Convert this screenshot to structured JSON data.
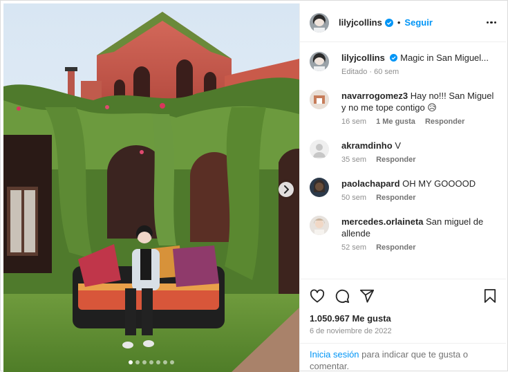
{
  "post": {
    "username": "lilyjcollins",
    "follow_label": "Seguir",
    "separator": "•",
    "caption": "Magic in San Miguel...",
    "caption_meta": "Editado · 60 sem",
    "carousel": {
      "slides": 7,
      "active_index": 0
    }
  },
  "comments": [
    {
      "user": "navarrogomez3",
      "text": "Hay no!!! San Miguel y no me tope contigo 😥",
      "age": "16 sem",
      "likes": "1 Me gusta",
      "reply": "Responder"
    },
    {
      "user": "akramdinho",
      "text": "V",
      "age": "35 sem",
      "likes": "",
      "reply": "Responder"
    },
    {
      "user": "paolachapard",
      "text": "OH MY GOOOOD",
      "age": "50 sem",
      "likes": "",
      "reply": "Responder"
    },
    {
      "user": "mercedes.orlaineta",
      "text": "San miguel de allende",
      "age": "52 sem",
      "likes": "",
      "reply": "Responder"
    }
  ],
  "stats": {
    "likes": "1.050.967 Me gusta",
    "date": "6 de noviembre de 2022"
  },
  "footer": {
    "login_link": "Inicia sesión",
    "login_text": " para indicar que te gusta o comentar."
  },
  "colors": {
    "accent": "#0095f6",
    "verified": "#0095f6",
    "text": "#262626",
    "muted": "#8e8e8e"
  }
}
